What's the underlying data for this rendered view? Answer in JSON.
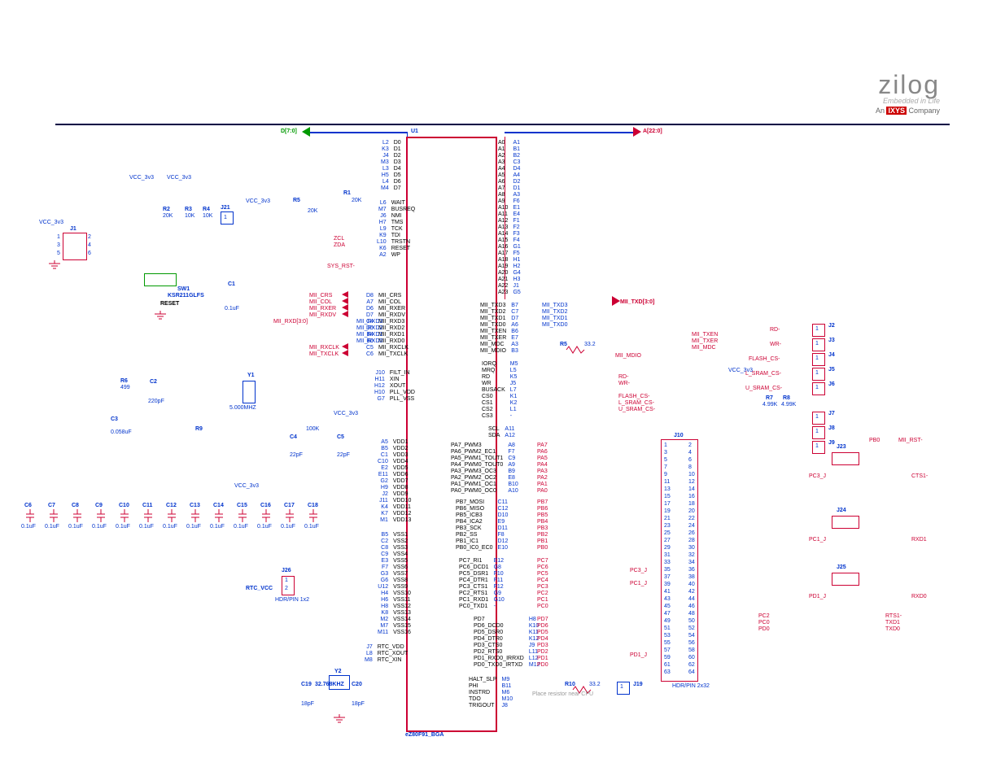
{
  "brand": {
    "logo": "zilog",
    "tag": "Embedded in Life",
    "company_prefix": "An ",
    "company_bold": "IXYS",
    "company_suffix": " Company"
  },
  "chip": {
    "ref": "U1",
    "part": "eZ80F91_BGA"
  },
  "buses": {
    "data": "D[7:0]",
    "addr": "A[22:0]"
  },
  "power": {
    "vcc3v3": "VCC_3v3",
    "rtc": "RTC_VCC"
  },
  "reset": {
    "sw_ref": "SW1",
    "sw_part": "KSR211GLFS",
    "label": "RESET",
    "net": "SYS_RST-",
    "c1": "C1",
    "c1_val": "0.1uF"
  },
  "pullups": {
    "r1": "R1",
    "r1_val": "20K",
    "r2": "R2",
    "r2_val": "20K",
    "r3": "R3",
    "r3_val": "10K",
    "r4": "R4",
    "r4_val": "10K",
    "r5p": "R5",
    "r5p_val": "20K"
  },
  "j1": "J1",
  "j21": "J21",
  "osc_main": {
    "y1": "Y1",
    "freq": "5.000MHZ",
    "r6": "R6",
    "r6_val": "499",
    "r9": "R9",
    "r9_val": "100K",
    "c2": "C2",
    "c2_val": "220pF",
    "c3": "C3",
    "c3_val": "0.058uF",
    "c4": "C4",
    "c5": "C5",
    "c45_val": "22pF"
  },
  "decouple": {
    "caps": [
      "C6",
      "C7",
      "C8",
      "C9",
      "C10",
      "C11",
      "C12",
      "C13",
      "C14",
      "C15",
      "C16",
      "C17",
      "C18"
    ],
    "val": "0.1uF"
  },
  "osc_rtc": {
    "y2": "Y2",
    "freq": "32.768KHZ",
    "c19": "C19",
    "c20": "C20",
    "cval": "18pF"
  },
  "j26": {
    "ref": "J26",
    "part": "HDR/PIN 1x2"
  },
  "series_r": {
    "r5": "R5",
    "r5_val": "33.2",
    "r10": "R10",
    "r10_val": "33.2"
  },
  "r7": "R7",
  "r7_val": "4.99K",
  "r8": "R8",
  "r8_val": "4.99K",
  "jtag": {
    "tms": "TMS",
    "tck": "TCK",
    "tdi": "TDI",
    "trstn": "TRSTN"
  },
  "i2c": {
    "scl": "ZCL",
    "sda": "ZDA"
  },
  "mii": {
    "crs": "MII_CRS",
    "col": "MII_COL",
    "rxer": "MII_RXER",
    "rxdv": "MII_RXDV",
    "rxd": "MII_RXD[3:0]",
    "rxclk": "MII_RXCLK",
    "txclk": "MII_TXCLK",
    "txen": "MII_TXEN",
    "txer": "MII_TXER",
    "mdc": "MII_MDC",
    "mdio": "MII_MDIO",
    "txd": "MII_TXD[3:0]",
    "txd3": "MII_TXD3",
    "txd2": "MII_TXD2",
    "txd1": "MII_TXD1",
    "txd0": "MII_TXD0",
    "rxd3": "MII_RXD3",
    "rxd2": "MII_RXD2",
    "rxd1": "MII_RXD1",
    "rxd0": "MII_RXD0"
  },
  "right_ports": {
    "rd": "RD-",
    "wr": "WR-",
    "flash": "FLASH_CS-",
    "lsram": "L_SRAM_CS-",
    "usram": "U_SRAM_CS-",
    "rts1": "RTS1-",
    "txd1": "TXD1",
    "txd0": "TXD0",
    "rxd1": "RXD1",
    "rxd0": "RXD0",
    "cts1": "CTS1-",
    "pb0": "PB0",
    "mii_rst": "MII_RST-"
  },
  "right_j": {
    "j2": "J2",
    "j3": "J3",
    "j4": "J4",
    "j5": "J5",
    "j6": "J6",
    "j7": "J7",
    "j8": "J8",
    "j9": "J9",
    "j23": "J23",
    "j24": "J24",
    "j25": "J25"
  },
  "j10": {
    "ref": "J10",
    "part": "HDR/PIN 2x32",
    "pins": "64"
  },
  "j19": "J19",
  "j19_note": "Place resistor near CPU",
  "u1_left_top": [
    [
      "L2",
      "D0"
    ],
    [
      "K3",
      "D1"
    ],
    [
      "J4",
      "D2"
    ],
    [
      "M3",
      "D3"
    ],
    [
      "L3",
      "D4"
    ],
    [
      "H5",
      "D5"
    ],
    [
      "L4",
      "D6"
    ],
    [
      "M4",
      "D7"
    ]
  ],
  "u1_left_ctrl": [
    [
      "L6",
      "WAIT"
    ],
    [
      "M7",
      "BUSREQ"
    ],
    [
      "J6",
      "NMI"
    ],
    [
      "H7",
      "TMS"
    ],
    [
      "L9",
      "TCK"
    ],
    [
      "K9",
      "TDI"
    ],
    [
      "L10",
      "TRSTN"
    ],
    [
      "K6",
      "RESET"
    ],
    [
      "A2",
      "WP"
    ]
  ],
  "u1_left_mii": [
    [
      "D8",
      "MII_CRS"
    ],
    [
      "A7",
      "MII_COL"
    ],
    [
      "D6",
      "MII_RXER"
    ],
    [
      "D7",
      "MII_RXDV"
    ],
    [
      "C4",
      "MII_RXD3"
    ],
    [
      "D5",
      "MII_RXD2"
    ],
    [
      "B4",
      "MII_RXD1"
    ],
    [
      "B6",
      "MII_RXD0"
    ],
    [
      "C5",
      "MII_RXCLK"
    ],
    [
      "C6",
      "MII_TXCLK"
    ]
  ],
  "u1_left_filt": [
    [
      "J10",
      "FILT_IN"
    ],
    [
      "H11",
      "XIN"
    ],
    [
      "H12",
      "XOUT"
    ],
    [
      "H10",
      "PLL_VDD"
    ],
    [
      "G7",
      "PLL_VSS"
    ]
  ],
  "u1_left_vdd": [
    [
      "A5",
      "VDD1"
    ],
    [
      "B5",
      "VDD2"
    ],
    [
      "C1",
      "VDD3"
    ],
    [
      "C10",
      "VDD4"
    ],
    [
      "E2",
      "VDD5"
    ],
    [
      "E11",
      "VDD6"
    ],
    [
      "G2",
      "VDD7"
    ],
    [
      "H9",
      "VDD8"
    ],
    [
      "J2",
      "VDD9"
    ],
    [
      "J11",
      "VDD10"
    ],
    [
      "K4",
      "VDD11"
    ],
    [
      "K7",
      "VDD12"
    ],
    [
      "M1",
      "VDD13"
    ]
  ],
  "u1_left_vss": [
    [
      "B5",
      "VSS1"
    ],
    [
      "C2",
      "VSS2"
    ],
    [
      "C8",
      "VSS3"
    ],
    [
      "C9",
      "VSS4"
    ],
    [
      "E3",
      "VSS5"
    ],
    [
      "F7",
      "VSS6"
    ],
    [
      "G3",
      "VSS7"
    ],
    [
      "G6",
      "VSS8"
    ],
    [
      "U12",
      "VSS9"
    ],
    [
      "H4",
      "VSS10"
    ],
    [
      "H6",
      "VSS11"
    ],
    [
      "H8",
      "VSS12"
    ],
    [
      "K8",
      "VSS13"
    ],
    [
      "M2",
      "VSS14"
    ],
    [
      "M7",
      "VSS15"
    ],
    [
      "M11",
      "VSS16"
    ]
  ],
  "u1_left_rtc": [
    [
      "J7",
      "RTC_VDD"
    ],
    [
      "L8",
      "RTC_XOUT"
    ],
    [
      "M8",
      "RTC_XIN"
    ]
  ],
  "u1_right_addr": [
    [
      "A0",
      "A1"
    ],
    [
      "A1",
      "B1"
    ],
    [
      "A2",
      "B2"
    ],
    [
      "A3",
      "C3"
    ],
    [
      "A4",
      "D4"
    ],
    [
      "A5",
      "A4"
    ],
    [
      "A6",
      "D2"
    ],
    [
      "A7",
      "D1"
    ],
    [
      "A8",
      "A3"
    ],
    [
      "A9",
      "F6"
    ],
    [
      "A10",
      "E1"
    ],
    [
      "A11",
      "E4"
    ],
    [
      "A12",
      "F1"
    ],
    [
      "A13",
      "F2"
    ],
    [
      "A14",
      "F3"
    ],
    [
      "A15",
      "F4"
    ],
    [
      "A16",
      "G1"
    ],
    [
      "A17",
      "F5"
    ],
    [
      "A18",
      "H1"
    ],
    [
      "A19",
      "H2"
    ],
    [
      "A20",
      "G4"
    ],
    [
      "A21",
      "H3"
    ],
    [
      "A22",
      "J1"
    ],
    [
      "A23",
      "G5"
    ]
  ],
  "u1_right_mii": [
    [
      "MII_TXD3",
      "B7"
    ],
    [
      "MII_TXD2",
      "C7"
    ],
    [
      "MII_TXD1",
      "D7"
    ],
    [
      "MII_TXD0",
      "A6"
    ],
    [
      "MII_TXEN",
      "B6"
    ],
    [
      "MII_TXER",
      "E7"
    ],
    [
      "MII_MDC",
      "A3"
    ],
    [
      "MII_MDIO",
      "B3"
    ]
  ],
  "u1_right_ctrl": [
    [
      "IORQ",
      "M5"
    ],
    [
      "MRQ",
      "L5"
    ],
    [
      "RD",
      "K5"
    ],
    [
      "WR",
      "J5"
    ],
    [
      "BUSACK",
      "L7"
    ],
    [
      "CS0",
      "K1"
    ],
    [
      "CS1",
      "K2"
    ],
    [
      "CS2",
      "L1"
    ],
    [
      "CS3",
      "-"
    ]
  ],
  "u1_right_scl": [
    [
      "SCL",
      "A11"
    ],
    [
      "SDA",
      "A12"
    ]
  ],
  "u1_right_pa": [
    [
      "PA7_PWM3",
      "A8",
      "PA7"
    ],
    [
      "PA6_PWM2_EC1",
      "F7",
      "PA6"
    ],
    [
      "PA5_PWM1_TOUT1",
      "C9",
      "PA5"
    ],
    [
      "PA4_PWM0_TOUT0",
      "A9",
      "PA4"
    ],
    [
      "PA3_PWM3_OC3",
      "B9",
      "PA3"
    ],
    [
      "PA2_PWM2_OC2",
      "E8",
      "PA2"
    ],
    [
      "PA1_PWM1_OC1",
      "B10",
      "PA1"
    ],
    [
      "PA0_PWM0_OC0",
      "A10",
      "PA0"
    ]
  ],
  "u1_right_pb": [
    [
      "PB7_MOSI",
      "C11",
      "PB7"
    ],
    [
      "PB6_MISO",
      "C12",
      "PB6"
    ],
    [
      "PB5_ICB3",
      "D10",
      "PB5"
    ],
    [
      "PB4_ICA2",
      "E9",
      "PB4"
    ],
    [
      "PB3_SCK",
      "D11",
      "PB3"
    ],
    [
      "PB2_SS",
      "F8",
      "PB2"
    ],
    [
      "PB1_IC1",
      "D12",
      "PB1"
    ],
    [
      "PB0_IC0_EC0",
      "E10",
      "PB0"
    ]
  ],
  "u1_right_pc": [
    [
      "PC7_RI1",
      "E12",
      "PC7"
    ],
    [
      "PC6_DCD1",
      "G8",
      "PC6"
    ],
    [
      "PC5_DSR1",
      "F10",
      "PC5"
    ],
    [
      "PC4_DTR1",
      "F11",
      "PC4"
    ],
    [
      "PC3_CTS1",
      "F12",
      "PC3"
    ],
    [
      "PC2_RTS1",
      "G9",
      "PC2"
    ],
    [
      "PC1_RXD1",
      "G10",
      "PC1"
    ],
    [
      "PC0_TXD1",
      "-",
      "PC0"
    ]
  ],
  "u1_right_pd": [
    [
      "PD7",
      "H8",
      "PD7"
    ],
    [
      "PD6_DCD0",
      "K10",
      "PD6"
    ],
    [
      "PD5_DSR0",
      "K11",
      "PD5"
    ],
    [
      "PD4_DTR0",
      "K12",
      "PD4"
    ],
    [
      "PD3_CTS0",
      "J9",
      "PD3"
    ],
    [
      "PD2_RTS0",
      "L11",
      "PD2"
    ],
    [
      "PD1_RXD0_IRRXD",
      "L12",
      "PD1"
    ],
    [
      "PD0_TXD0_IRTXD",
      "M12",
      "PD0"
    ]
  ],
  "u1_right_bot": [
    [
      "HALT_SLP",
      "M9"
    ],
    [
      "PHI",
      "B11"
    ],
    [
      "INSTRD",
      "M6"
    ],
    [
      "TDO",
      "M10"
    ],
    [
      "TRIGOUT",
      "J8"
    ]
  ],
  "pc_j_nets": [
    "PC3_J",
    "PC1_J",
    "PD1_J"
  ],
  "pc_right_nets": [
    "PC2",
    "PC0",
    "PD0"
  ]
}
